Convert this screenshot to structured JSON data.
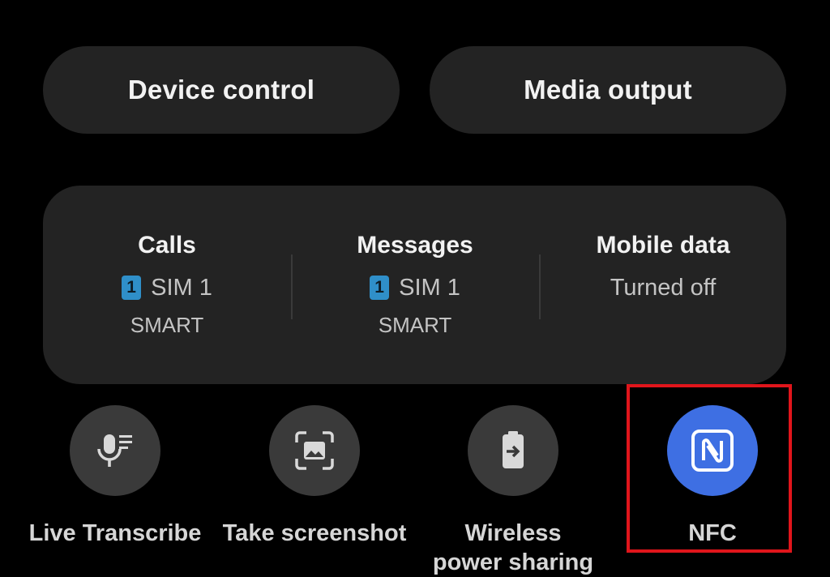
{
  "quick_buttons": {
    "device_control": "Device control",
    "media_output": "Media output"
  },
  "sim_panel": {
    "calls": {
      "title": "Calls",
      "sim_number": "1",
      "sim_label": "SIM 1",
      "carrier": "SMART"
    },
    "messages": {
      "title": "Messages",
      "sim_number": "1",
      "sim_label": "SIM 1",
      "carrier": "SMART"
    },
    "mobile_data": {
      "title": "Mobile data",
      "status": "Turned off"
    }
  },
  "tiles": [
    {
      "label": "Live Transcribe",
      "icon": "microphone-transcribe-icon",
      "active": false
    },
    {
      "label": "Take screenshot",
      "icon": "screenshot-icon",
      "active": false
    },
    {
      "label": "Wireless\npower sharing",
      "icon": "battery-share-icon",
      "active": false
    },
    {
      "label": "NFC",
      "icon": "nfc-icon",
      "active": true
    }
  ],
  "colors": {
    "background": "#000000",
    "panel": "#232323",
    "tile_inactive": "#3a3a3a",
    "tile_active": "#3e6fe3",
    "sim_badge": "#2f8fc9",
    "highlight": "#e0151b"
  }
}
